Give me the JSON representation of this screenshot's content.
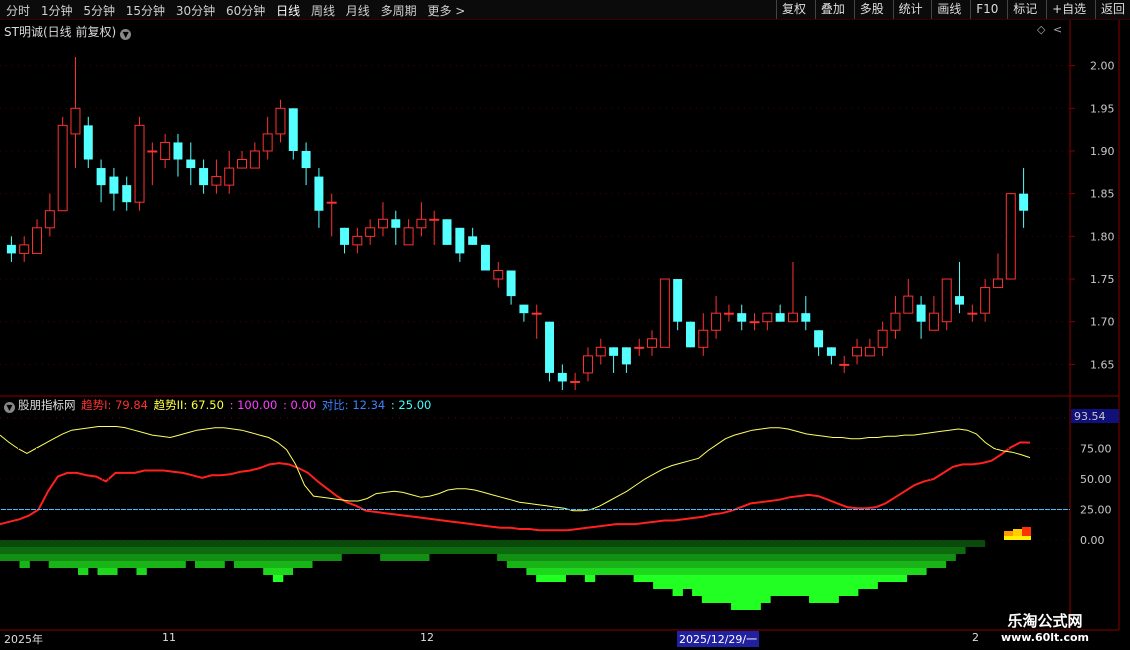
{
  "toolbar": {
    "periods": [
      "分时",
      "1分钟",
      "5分钟",
      "15分钟",
      "30分钟",
      "60分钟",
      "日线",
      "周线",
      "月线",
      "多周期",
      "更多 >"
    ],
    "active_period": "日线",
    "buttons": [
      "复权",
      "叠加",
      "多股",
      "统计",
      "画线",
      "F10",
      "标记",
      "+自选",
      "返回"
    ]
  },
  "main_chart": {
    "title": "ST明诚(日线 前复权)",
    "y_ticks": [
      "2.00",
      "1.95",
      "1.90",
      "1.85",
      "1.80",
      "1.75",
      "1.70",
      "1.65"
    ]
  },
  "indicator": {
    "name": "股朋指标网",
    "items": [
      {
        "label": "趋势I: 79.84",
        "color": "#ff3030"
      },
      {
        "label": "趋势II: 67.50",
        "color": "#ffff40"
      },
      {
        "label": ": 100.00",
        "color": "#ff40ff"
      },
      {
        "label": ": 0.00",
        "color": "#ff40ff"
      },
      {
        "label": "对比: 12.34",
        "color": "#4080ff"
      },
      {
        "label": ": 25.00",
        "color": "#40ffff"
      }
    ],
    "y_ticks": [
      "75.00",
      "50.00",
      "25.00",
      "0.00"
    ],
    "current_value": "93.54"
  },
  "date_axis": {
    "labels": [
      "2025年",
      "11",
      "12",
      "2025/12/29/一",
      "2"
    ]
  },
  "watermark": {
    "line1": "乐淘公式网",
    "line2": "www.60lt.com"
  },
  "chart_data": {
    "type": "candlestick",
    "ylim": [
      1.62,
      2.03
    ],
    "candles": [
      [
        1.79,
        1.78,
        1.8,
        1.77
      ],
      [
        1.78,
        1.79,
        1.8,
        1.77
      ],
      [
        1.78,
        1.81,
        1.82,
        1.78
      ],
      [
        1.81,
        1.83,
        1.85,
        1.8
      ],
      [
        1.83,
        1.93,
        1.94,
        1.83
      ],
      [
        1.92,
        1.95,
        2.01,
        1.88
      ],
      [
        1.93,
        1.89,
        1.94,
        1.88
      ],
      [
        1.88,
        1.86,
        1.89,
        1.84
      ],
      [
        1.87,
        1.85,
        1.88,
        1.83
      ],
      [
        1.86,
        1.84,
        1.87,
        1.83
      ],
      [
        1.84,
        1.93,
        1.94,
        1.83
      ],
      [
        1.9,
        1.9,
        1.91,
        1.86
      ],
      [
        1.89,
        1.91,
        1.92,
        1.88
      ],
      [
        1.91,
        1.89,
        1.92,
        1.87
      ],
      [
        1.89,
        1.88,
        1.91,
        1.86
      ],
      [
        1.88,
        1.86,
        1.89,
        1.85
      ],
      [
        1.86,
        1.87,
        1.89,
        1.85
      ],
      [
        1.86,
        1.88,
        1.9,
        1.85
      ],
      [
        1.88,
        1.89,
        1.9,
        1.88
      ],
      [
        1.88,
        1.9,
        1.91,
        1.88
      ],
      [
        1.9,
        1.92,
        1.94,
        1.89
      ],
      [
        1.92,
        1.95,
        1.96,
        1.91
      ],
      [
        1.95,
        1.9,
        1.95,
        1.89
      ],
      [
        1.9,
        1.88,
        1.91,
        1.86
      ],
      [
        1.87,
        1.83,
        1.88,
        1.81
      ],
      [
        1.84,
        1.84,
        1.85,
        1.8
      ],
      [
        1.81,
        1.79,
        1.81,
        1.78
      ],
      [
        1.79,
        1.8,
        1.81,
        1.78
      ],
      [
        1.8,
        1.81,
        1.82,
        1.79
      ],
      [
        1.81,
        1.82,
        1.84,
        1.8
      ],
      [
        1.82,
        1.81,
        1.83,
        1.79
      ],
      [
        1.79,
        1.81,
        1.82,
        1.79
      ],
      [
        1.81,
        1.82,
        1.84,
        1.8
      ],
      [
        1.82,
        1.82,
        1.83,
        1.79
      ],
      [
        1.82,
        1.79,
        1.82,
        1.79
      ],
      [
        1.81,
        1.78,
        1.81,
        1.77
      ],
      [
        1.8,
        1.79,
        1.81,
        1.79
      ],
      [
        1.79,
        1.76,
        1.79,
        1.76
      ],
      [
        1.75,
        1.76,
        1.77,
        1.74
      ],
      [
        1.76,
        1.73,
        1.76,
        1.72
      ],
      [
        1.72,
        1.71,
        1.72,
        1.7
      ],
      [
        1.71,
        1.71,
        1.72,
        1.68
      ],
      [
        1.7,
        1.64,
        1.7,
        1.63
      ],
      [
        1.64,
        1.63,
        1.65,
        1.62
      ],
      [
        1.63,
        1.63,
        1.64,
        1.62
      ],
      [
        1.64,
        1.66,
        1.67,
        1.63
      ],
      [
        1.66,
        1.67,
        1.68,
        1.65
      ],
      [
        1.67,
        1.66,
        1.67,
        1.64
      ],
      [
        1.67,
        1.65,
        1.67,
        1.64
      ],
      [
        1.67,
        1.67,
        1.68,
        1.66
      ],
      [
        1.67,
        1.68,
        1.69,
        1.66
      ],
      [
        1.67,
        1.75,
        1.75,
        1.67
      ],
      [
        1.75,
        1.7,
        1.75,
        1.69
      ],
      [
        1.7,
        1.67,
        1.7,
        1.67
      ],
      [
        1.67,
        1.69,
        1.71,
        1.66
      ],
      [
        1.69,
        1.71,
        1.73,
        1.68
      ],
      [
        1.71,
        1.71,
        1.72,
        1.7
      ],
      [
        1.71,
        1.7,
        1.72,
        1.69
      ],
      [
        1.7,
        1.7,
        1.71,
        1.69
      ],
      [
        1.7,
        1.71,
        1.71,
        1.69
      ],
      [
        1.71,
        1.7,
        1.72,
        1.7
      ],
      [
        1.7,
        1.71,
        1.77,
        1.7
      ],
      [
        1.71,
        1.7,
        1.73,
        1.69
      ],
      [
        1.69,
        1.67,
        1.69,
        1.66
      ],
      [
        1.67,
        1.66,
        1.67,
        1.65
      ],
      [
        1.65,
        1.65,
        1.66,
        1.64
      ],
      [
        1.66,
        1.67,
        1.68,
        1.65
      ],
      [
        1.66,
        1.67,
        1.68,
        1.66
      ],
      [
        1.67,
        1.69,
        1.7,
        1.66
      ],
      [
        1.69,
        1.71,
        1.73,
        1.68
      ],
      [
        1.71,
        1.73,
        1.75,
        1.71
      ],
      [
        1.72,
        1.7,
        1.73,
        1.68
      ],
      [
        1.69,
        1.71,
        1.73,
        1.69
      ],
      [
        1.7,
        1.75,
        1.75,
        1.69
      ],
      [
        1.73,
        1.72,
        1.77,
        1.71
      ],
      [
        1.71,
        1.71,
        1.72,
        1.7
      ],
      [
        1.71,
        1.74,
        1.75,
        1.7
      ],
      [
        1.74,
        1.75,
        1.78,
        1.74
      ],
      [
        1.75,
        1.85,
        1.85,
        1.75
      ],
      [
        1.85,
        1.83,
        1.88,
        1.81
      ]
    ],
    "series": [
      {
        "name": "趋势I",
        "color": "#ff2020",
        "values": [
          13,
          15,
          17,
          20,
          25,
          40,
          52,
          55,
          55,
          53,
          52,
          48,
          55,
          55,
          55,
          57,
          57,
          57,
          56,
          55,
          53,
          51,
          53,
          53,
          54,
          56,
          57,
          59,
          62,
          63,
          62,
          59,
          55,
          48,
          42,
          36,
          31,
          28,
          24,
          23,
          22,
          21,
          20,
          19,
          18,
          17,
          16,
          15,
          14,
          13,
          12,
          11,
          10,
          10,
          9,
          9,
          8,
          8,
          8,
          8,
          9,
          10,
          11,
          12,
          13,
          13,
          13,
          14,
          15,
          16,
          16,
          17,
          18,
          19,
          21,
          22,
          24,
          27,
          30,
          31,
          32,
          33,
          35,
          36,
          37,
          36,
          33,
          30,
          27,
          26,
          26,
          27,
          30,
          35,
          40,
          45,
          48,
          50,
          55,
          60,
          62,
          62,
          63,
          65,
          70,
          76,
          80,
          79.84
        ]
      },
      {
        "name": "趋势II",
        "color": "#ffff60",
        "values": [
          86,
          80,
          75,
          71,
          75,
          79,
          83,
          87,
          90,
          91,
          92,
          93,
          93,
          93,
          92,
          90,
          88,
          86,
          85,
          84,
          86,
          88,
          90,
          91,
          92,
          92,
          91,
          90,
          88,
          86,
          84,
          80,
          74,
          62,
          45,
          36,
          35,
          34,
          33,
          32,
          32,
          34,
          38,
          39,
          40,
          39,
          37,
          35,
          36,
          38,
          41,
          42,
          42,
          41,
          39,
          37,
          35,
          33,
          31,
          30,
          29,
          28,
          27,
          26,
          24,
          24,
          25,
          28,
          32,
          36,
          40,
          45,
          50,
          54,
          58,
          61,
          63,
          65,
          67,
          73,
          78,
          83,
          86,
          88,
          90,
          91,
          92,
          92,
          91,
          89,
          87,
          86,
          85,
          84,
          84,
          83,
          83,
          84,
          84,
          85,
          85,
          86,
          86,
          87,
          88,
          89,
          90,
          91,
          90,
          87,
          80,
          75,
          73,
          72,
          70,
          67.5
        ]
      },
      {
        "name": "对比",
        "color": "#40c0ff",
        "values": [
          25,
          25,
          25,
          25,
          25,
          25,
          25,
          25,
          25,
          25,
          25,
          25,
          25,
          25,
          25,
          25,
          25,
          25,
          25,
          25,
          25,
          25,
          25,
          25,
          25,
          25,
          25,
          25,
          25,
          25,
          25,
          25,
          25,
          25,
          25,
          25,
          25,
          25,
          25,
          25,
          25,
          25,
          25,
          25,
          25,
          25,
          25,
          25,
          25,
          25,
          25,
          25,
          25,
          25,
          25,
          25,
          25,
          25,
          25,
          25,
          25,
          25,
          25,
          25,
          25,
          25,
          25,
          25,
          25,
          25,
          25,
          25,
          25,
          25,
          25,
          25,
          25,
          25,
          25,
          25,
          25,
          25,
          25,
          25,
          25,
          25,
          25,
          25,
          25,
          25,
          25,
          25,
          25,
          25,
          25,
          25
        ]
      }
    ],
    "histogram_depth": [
      3,
      3,
      4,
      3,
      3,
      4,
      4,
      4,
      5,
      4,
      5,
      5,
      4,
      4,
      5,
      4,
      4,
      4,
      4,
      3,
      4,
      4,
      4,
      3,
      4,
      4,
      4,
      5,
      6,
      5,
      4,
      4,
      3,
      3,
      3,
      2,
      2,
      2,
      2,
      3,
      3,
      3,
      3,
      3,
      2,
      2,
      2,
      2,
      2,
      2,
      2,
      3,
      4,
      4,
      5,
      6,
      6,
      6,
      5,
      5,
      6,
      5,
      5,
      5,
      5,
      6,
      6,
      7,
      7,
      8,
      7,
      8,
      9,
      9,
      9,
      10,
      10,
      10,
      9,
      8,
      8,
      8,
      8,
      9,
      9,
      9,
      8,
      8,
      7,
      7,
      6,
      6,
      6,
      5,
      5,
      4,
      4,
      3,
      2,
      1,
      1,
      0,
      0
    ]
  }
}
